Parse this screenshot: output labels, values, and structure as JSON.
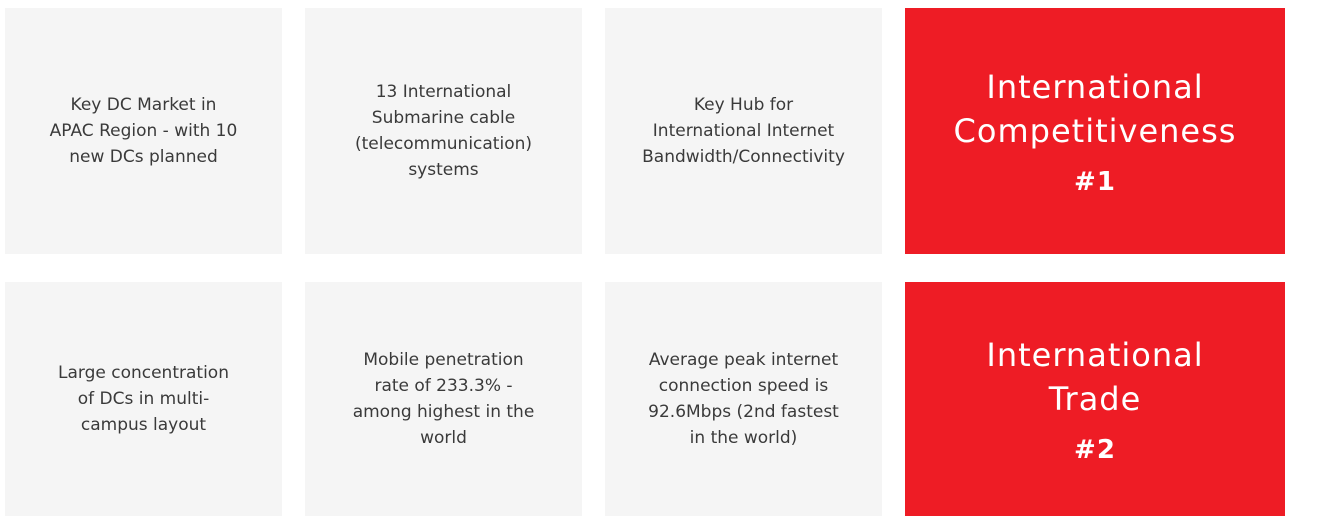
{
  "cards": [
    {
      "text": "Key DC Market in APAC Region - with 10 new DCs planned"
    },
    {
      "text": "13 International Submarine cable (telecommunication) systems"
    },
    {
      "text": "Key Hub for International Internet Bandwidth/Connectivity"
    },
    {
      "text": "Large concentration of DCs in multi-campus layout"
    },
    {
      "text": "Mobile penetration rate of 233.3% - among highest in the world"
    },
    {
      "text": "Average peak internet connection speed is 92.6Mbps (2nd fastest in the world)"
    }
  ],
  "rankings": [
    {
      "title": "International Competitiveness",
      "rank": "#1"
    },
    {
      "title": "International Trade",
      "rank": "#2"
    }
  ],
  "colors": {
    "card_grey": "#f5f5f5",
    "accent_red": "#ee1c25"
  }
}
